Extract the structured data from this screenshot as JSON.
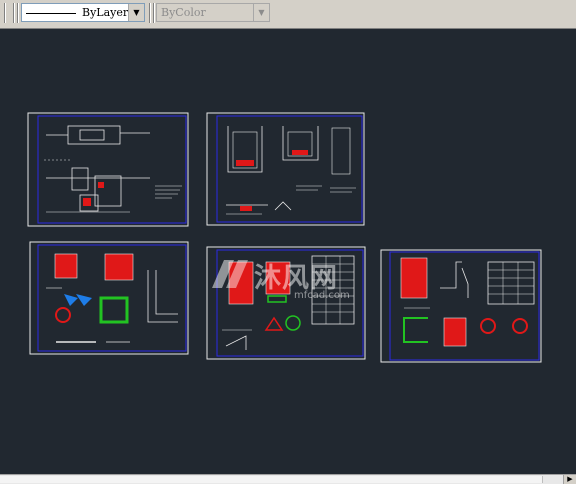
{
  "toolbar": {
    "linetype_label": "ByLayer",
    "color_label": "ByColor"
  },
  "watermark": {
    "brand": "沐风网",
    "url": "mfcad.com"
  },
  "colors": {
    "background": "#212830",
    "sheet_border": "#2a2ae6",
    "drawing_white": "#e8e8e8",
    "fill_red": "#e01818",
    "fill_green": "#22c322",
    "fill_blue": "#1e7de8"
  },
  "sheets": [
    {
      "id": "sheet-1",
      "content": "plan-and-section"
    },
    {
      "id": "sheet-2",
      "content": "well-sections"
    },
    {
      "id": "sheet-3",
      "content": "rebar-details"
    },
    {
      "id": "sheet-4",
      "content": "rebar-table"
    },
    {
      "id": "sheet-5",
      "content": "rebar-table-and-details"
    }
  ]
}
